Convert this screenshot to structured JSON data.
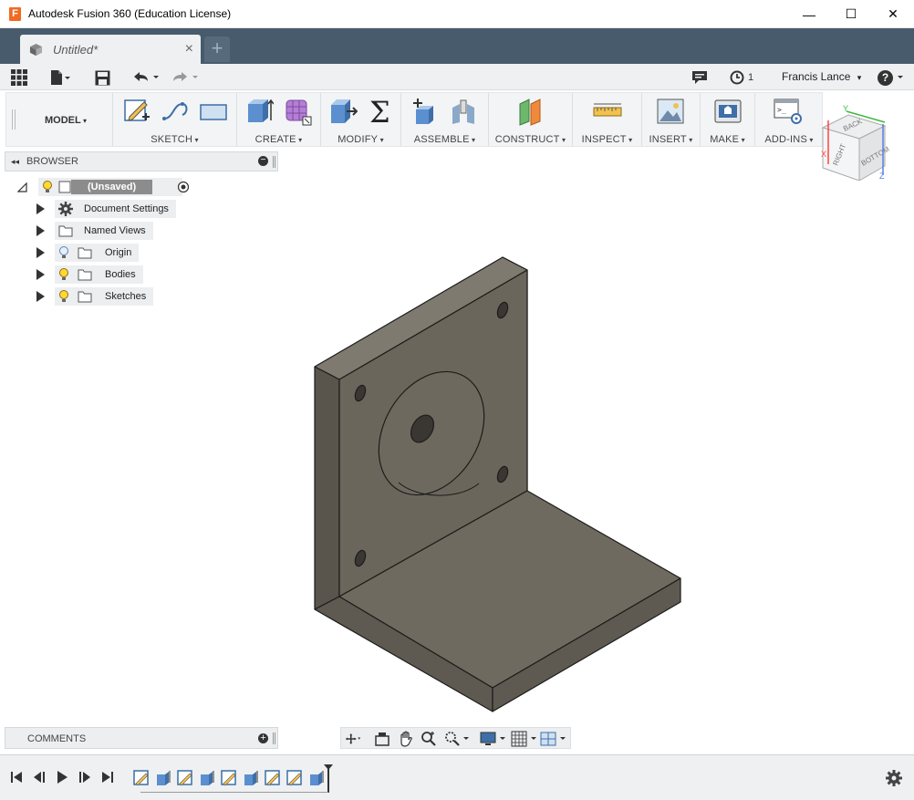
{
  "window": {
    "app_icon_letter": "F",
    "title": "Autodesk Fusion 360 (Education License)",
    "minimize": "—",
    "maximize": "☐",
    "close": "✕"
  },
  "tabs": [
    {
      "label": "Untitled*",
      "close": "×"
    }
  ],
  "new_tab": "+",
  "quick_access": {
    "job_count": "1",
    "user": "Francis Lance",
    "user_caret": "▾",
    "help": "?"
  },
  "toolbar": {
    "workspace": "MODEL",
    "groups": [
      {
        "label": "SKETCH"
      },
      {
        "label": "CREATE"
      },
      {
        "label": "MODIFY"
      },
      {
        "label": "ASSEMBLE"
      },
      {
        "label": "CONSTRUCT"
      },
      {
        "label": "INSPECT"
      },
      {
        "label": "INSERT"
      },
      {
        "label": "MAKE"
      },
      {
        "label": "ADD-INS"
      }
    ]
  },
  "viewcube": {
    "faces": [
      "BACK",
      "RIGHT",
      "BOTTOM"
    ],
    "axes": [
      "Y",
      "X",
      "Z"
    ]
  },
  "browser": {
    "title": "BROWSER",
    "collapse": "◂◂",
    "minus": "−",
    "root": "(Unsaved)",
    "items": [
      {
        "label": "Document Settings"
      },
      {
        "label": "Named Views"
      },
      {
        "label": "Origin"
      },
      {
        "label": "Bodies"
      },
      {
        "label": "Sketches"
      }
    ]
  },
  "comments": {
    "title": "COMMENTS",
    "plus": "+"
  },
  "colors": {
    "tabstrip": "#485b6d",
    "body_face_front": "#6b665c",
    "body_face_top": "#7f7a6f",
    "body_face_side": "#59554c",
    "accent": "#f26a22"
  }
}
